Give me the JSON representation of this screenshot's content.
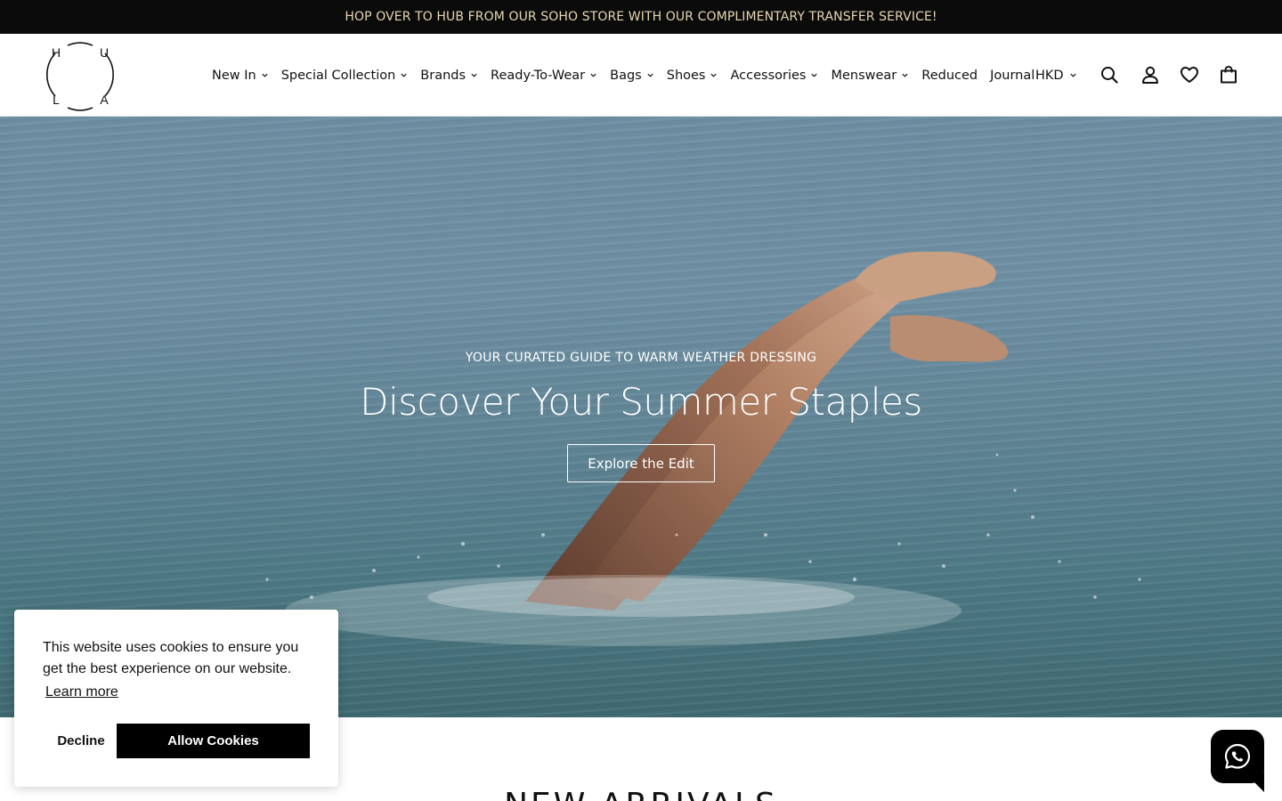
{
  "announcement": "HOP OVER TO HUB FROM OUR SOHO STORE WITH OUR COMPLIMENTARY TRANSFER SERVICE!",
  "logo": {
    "letters": [
      "H",
      "U",
      "L",
      "A"
    ]
  },
  "nav": {
    "items": [
      {
        "label": "New In",
        "dropdown": true
      },
      {
        "label": "Special Collection",
        "dropdown": true
      },
      {
        "label": "Brands",
        "dropdown": true
      },
      {
        "label": "Ready-To-Wear",
        "dropdown": true
      },
      {
        "label": "Bags",
        "dropdown": true
      },
      {
        "label": "Shoes",
        "dropdown": true
      },
      {
        "label": "Accessories",
        "dropdown": true
      },
      {
        "label": "Menswear",
        "dropdown": true
      },
      {
        "label": "Reduced",
        "dropdown": false
      },
      {
        "label": "Journal",
        "dropdown": false
      }
    ]
  },
  "currency": {
    "selected": "HKD"
  },
  "header_icons": [
    "search-icon",
    "account-icon",
    "wishlist-heart-icon",
    "cart-bag-icon"
  ],
  "hero": {
    "kicker": "YOUR CURATED GUIDE TO WARM WEATHER DRESSING",
    "title": "Discover Your Summer Staples",
    "cta": "Explore the Edit"
  },
  "section": {
    "title": "NEW ARRIVALS"
  },
  "cookie": {
    "message": "This website uses cookies to ensure you get the best experience on our website.",
    "learn_more": "Learn more",
    "decline": "Decline",
    "allow": "Allow Cookies"
  },
  "chat": {
    "icon": "whatsapp-icon"
  },
  "colors": {
    "announcement_bg": "#0b0b0b",
    "announcement_text": "#e6d6b0",
    "accent": "#000000"
  }
}
